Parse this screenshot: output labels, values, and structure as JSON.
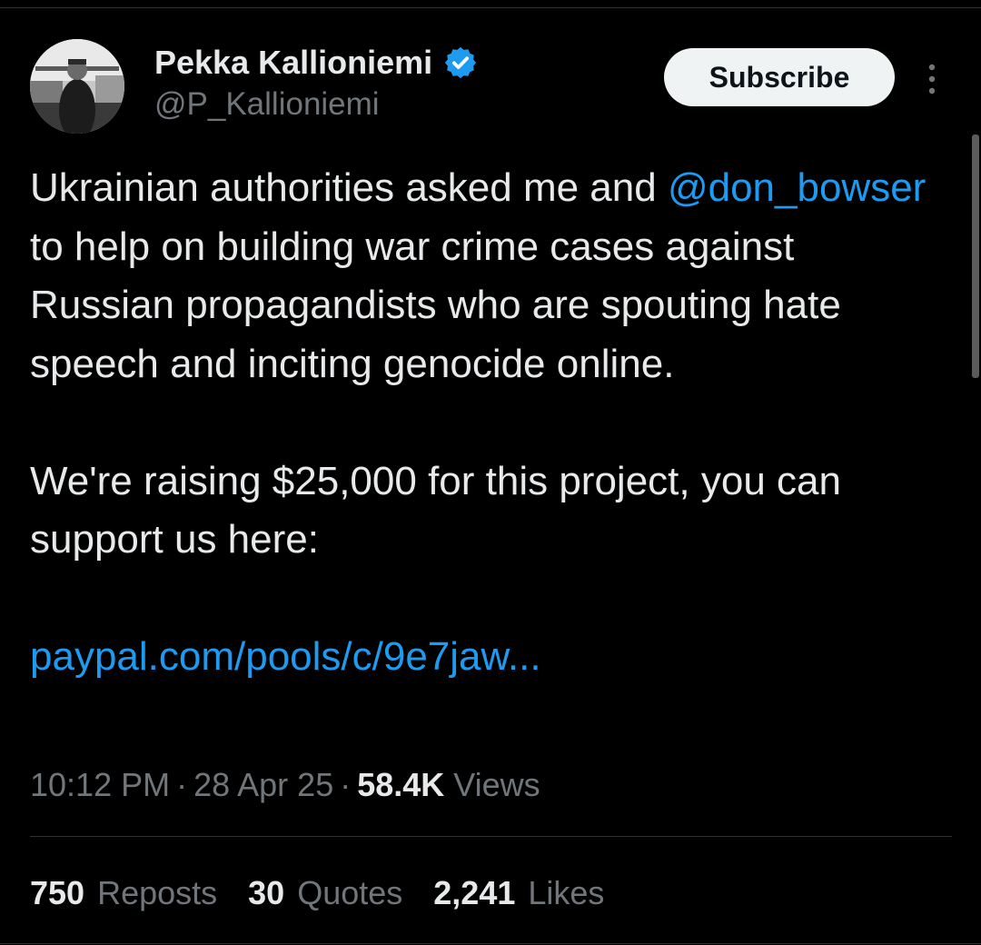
{
  "author": {
    "name": "Pekka Kallioniemi",
    "handle": "@P_Kallioniemi",
    "verified_badge_icon": "verified-badge-icon",
    "verified_color": "#1d9bf0"
  },
  "header": {
    "subscribe_label": "Subscribe",
    "more_icon": "more-vertical-icon"
  },
  "tweet": {
    "text_before_mention": "Ukrainian authorities asked me and ",
    "mention": "@don_bowser",
    "text_after_mention": " to help on building war crime cases against Russian propagandists who are spouting hate speech and inciting genocide online.",
    "paragraph2": "We're raising $25,000 for this project, you can support us here:",
    "link": "paypal.com/pools/c/9e7jaw..."
  },
  "meta": {
    "time": "10:12 PM",
    "separator": "·",
    "date": "28 Apr 25",
    "views_count": "58.4K",
    "views_label": "Views"
  },
  "stats": {
    "reposts_count": "750",
    "reposts_label": "Reposts",
    "quotes_count": "30",
    "quotes_label": "Quotes",
    "likes_count": "2,241",
    "likes_label": "Likes"
  },
  "colors": {
    "background": "#000000",
    "text": "#e7e9ea",
    "secondary": "#71767b",
    "accent": "#1d9bf0",
    "divider": "#2f3336"
  }
}
